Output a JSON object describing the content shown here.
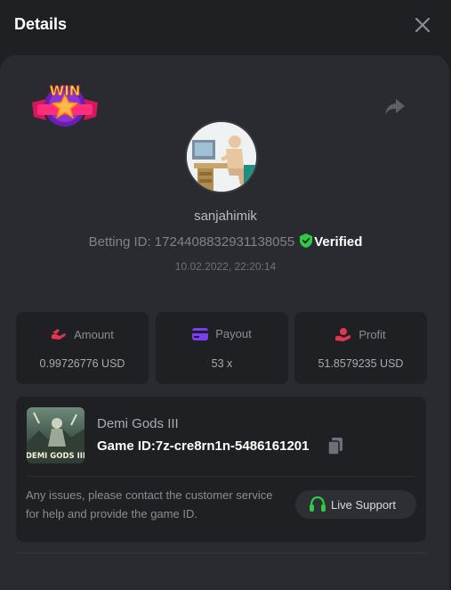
{
  "header": {
    "title": "Details"
  },
  "profile": {
    "badge_text": "WIN",
    "username": "sanjahimik",
    "betting_id_label": "Betting ID: 1724408832931138055",
    "verified_label": "Verified",
    "timestamp": "10.02.2022, 22:20:14"
  },
  "stats": [
    {
      "label": "Amount",
      "value": "0.99726776 USD",
      "icon": "amount-icon",
      "color": "#e0364f"
    },
    {
      "label": "Payout",
      "value": "53 x",
      "icon": "payout-icon",
      "color": "#7b3ff2"
    },
    {
      "label": "Profit",
      "value": "51.8579235 USD",
      "icon": "profit-icon",
      "color": "#e0364f"
    }
  ],
  "game": {
    "name": "Demi Gods III",
    "id_label": "Game ID:7z-cre8rn1n-5486161201",
    "thumb_text": "DEMI GODS III",
    "note": "Any issues, please contact the customer service for help and provide the game ID.",
    "support_label": "Live Support"
  },
  "colors": {
    "verified": "#2ecc40",
    "support": "#2ecc40",
    "background": "#1f2024",
    "panel": "#2a2b30"
  }
}
